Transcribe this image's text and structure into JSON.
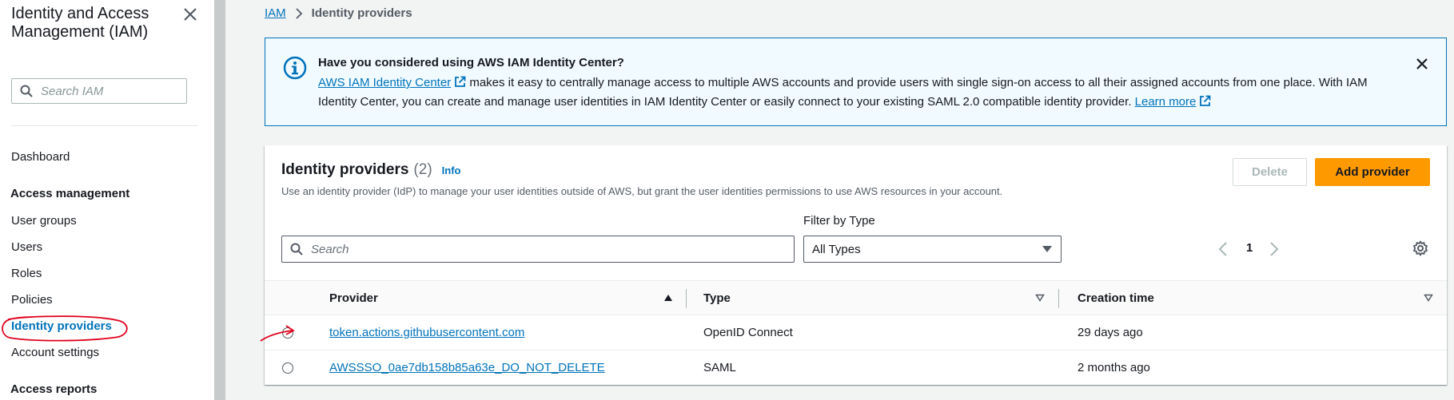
{
  "sidebar": {
    "title": "Identity and Access Management (IAM)",
    "search_placeholder": "Search IAM",
    "dashboard": "Dashboard",
    "section_access_management": "Access management",
    "items": [
      "User groups",
      "Users",
      "Roles",
      "Policies",
      "Identity providers",
      "Account settings"
    ],
    "active_item": "Identity providers",
    "section_access_reports": "Access reports"
  },
  "breadcrumb": {
    "root": "IAM",
    "current": "Identity providers"
  },
  "banner": {
    "title": "Have you considered using AWS IAM Identity Center?",
    "link_text": "AWS IAM Identity Center",
    "body_part1": " makes it easy to centrally manage access to multiple AWS accounts and provide users with single sign-on access to all their assigned accounts from one place. With IAM Identity Center, you can create and manage user identities in IAM Identity Center or easily connect to your existing SAML 2.0 compatible identity provider. ",
    "learn_more": "Learn more"
  },
  "panel": {
    "title": "Identity providers",
    "count": "(2)",
    "info": "Info",
    "description": "Use an identity provider (IdP) to manage your user identities outside of AWS, but grant the user identities permissions to use AWS resources in your account.",
    "delete_label": "Delete",
    "add_label": "Add provider",
    "filter_label": "Filter by Type",
    "search_placeholder": "Search",
    "filter_value": "All Types",
    "page_number": "1"
  },
  "table": {
    "columns": [
      "Provider",
      "Type",
      "Creation time"
    ],
    "rows": [
      {
        "provider": "token.actions.githubusercontent.com",
        "type": "OpenID Connect",
        "created": "29 days ago"
      },
      {
        "provider": "AWSSSO_0ae7db158b85a63e_DO_NOT_DELETE",
        "type": "SAML",
        "created": "2 months ago"
      }
    ]
  },
  "colors": {
    "accent": "#0073bb",
    "primary_button": "#ff9900",
    "annotation": "#e0001b"
  }
}
